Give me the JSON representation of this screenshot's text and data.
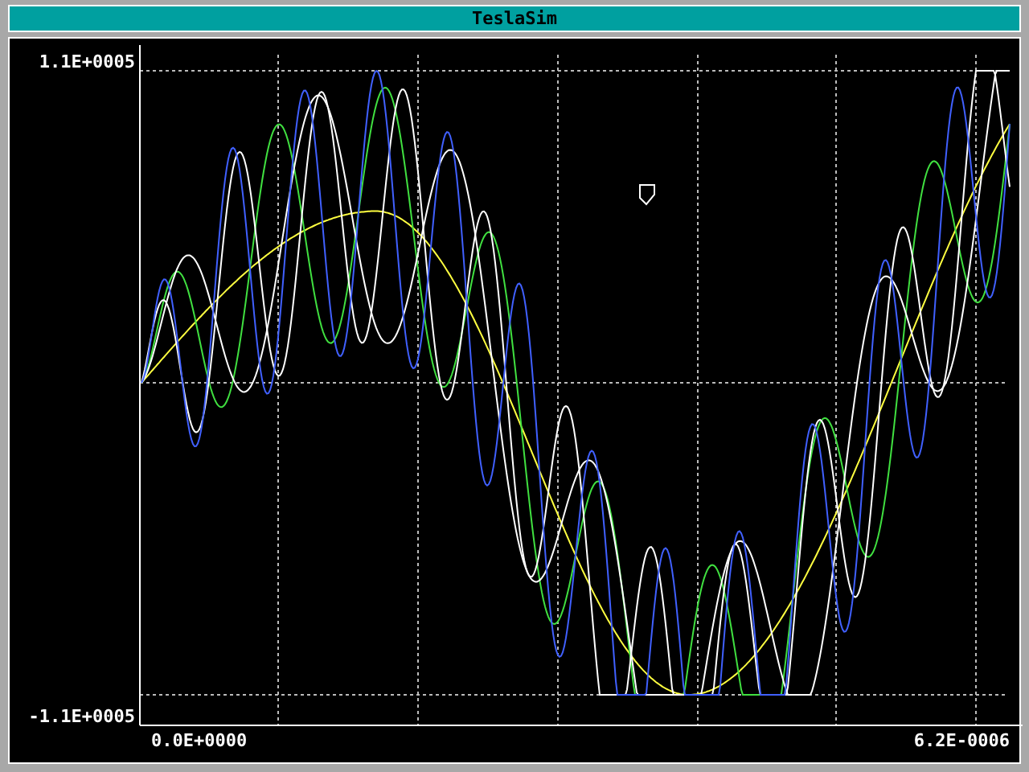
{
  "window": {
    "title": "TeslaSim"
  },
  "y_axis": {
    "top_label": "1.1E+0005",
    "bottom_label": "-1.1E+0005"
  },
  "x_axis": {
    "start_label": "0.0E+0000",
    "end_label": "6.2E-0006"
  }
}
